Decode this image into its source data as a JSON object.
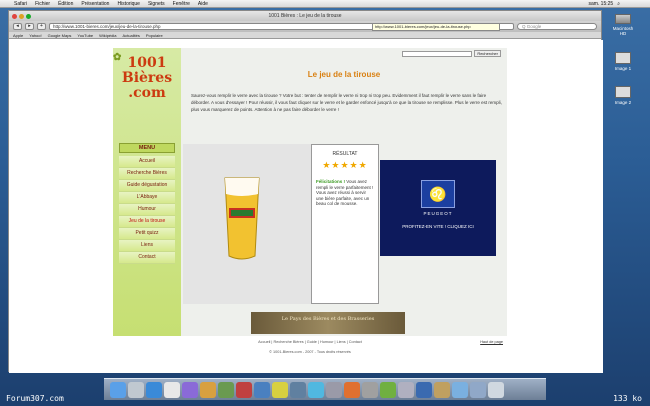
{
  "menubar": {
    "items": [
      "Safari",
      "Fichier",
      "Édition",
      "Présentation",
      "Historique",
      "Signets",
      "Fenêtre",
      "Aide"
    ],
    "clock": "sam. 15:25"
  },
  "window": {
    "title": "1001 Bières : Le jeu de la tirouse",
    "url": "http://www.1001-bieres.com/jeux/jeu-de-la-tirouse.php",
    "search_placeholder": "Q Google",
    "bookmarks": [
      "Apple",
      "Yahoo!",
      "Google Maps",
      "YouTube",
      "Wikipédia",
      "Actualités",
      "Populaire"
    ],
    "tooltip": "http://www.1001-bieres.com/jeux/jeu-de-la-tirouse.php"
  },
  "site": {
    "logo_line1": "1001",
    "logo_line2": "Bières",
    "logo_line3": ".com",
    "menu_title": "MENU",
    "nav": [
      "Accueil",
      "Recherche Bières",
      "Guide dégustation",
      "L'Abbaye",
      "Humour",
      "Jeu de la tirouse",
      "Petit quizz",
      "Liens",
      "Contact"
    ],
    "nav_active_index": 5,
    "search_button": "Rechercher",
    "heading": "Le jeu de la tirouse",
    "intro": "Saurez-vous remplir le verre avec la tirouse ? Votre but : tenter de remplir le verre ni trop ni trop peu. Evidemment il faut remplir le verre sans le faire déborder. A vous d'essayer ! Pour réussir, il vous faut cliquer sur le verre et le garder enfoncé jusqu'à ce que la tirouse se remplisse. Plus le verre est rempli, plus vous marquerez de points. Attention à ne pas faire déborder le verre !",
    "result_title": "RÉSULTAT",
    "stars": "★★★★★",
    "result_label": "Félicitations !",
    "result_text": "Vous avez rempli le verre parfaitement ! Vous avez réussi à servir une bière parfaite, avec un beau col de mousse.",
    "ad_brand": "PEUGEOT",
    "ad_cta": "PROFITEZ-EN VITE ! CLIQUEZ ICI",
    "banner_text": "Le Pays des Bières et des Brasseries",
    "footer_line1": "Accueil | Recherche Bières | Guide | Humour | Liens | Contact",
    "footer_line2": "© 1001-Bieres.com - 2007 - Tous droits réservés",
    "top_link": "Haut de page"
  },
  "desktop": {
    "icon1": "Image 1",
    "icon2": "Image 2",
    "hd_label": "Macintosh HD"
  },
  "status": {
    "left": "Forum307.com",
    "right": "133 ko"
  }
}
